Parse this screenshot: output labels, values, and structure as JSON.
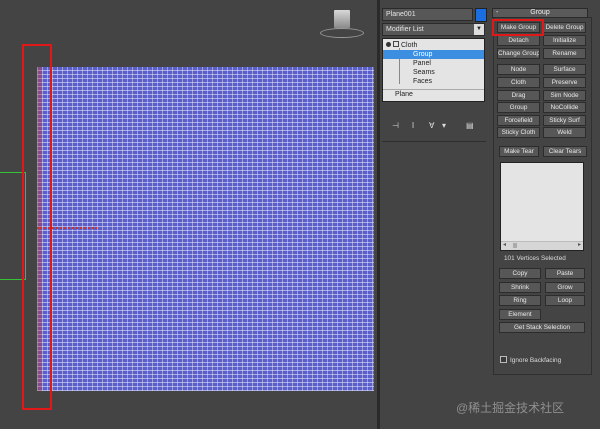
{
  "object": {
    "name": "Plane001",
    "color": "#1a6ee0"
  },
  "modifier_list": {
    "label": "Modifier List"
  },
  "stack": {
    "items": [
      {
        "label": "Cloth"
      },
      {
        "label": "Group"
      },
      {
        "label": "Panel"
      },
      {
        "label": "Seams"
      },
      {
        "label": "Faces"
      }
    ],
    "base": "Plane"
  },
  "rollout": {
    "title": "Group",
    "buttons": [
      "Make Group",
      "Delete Group",
      "Detach",
      "Initialize",
      "Change Group",
      "Rename",
      "Node",
      "Surface",
      "Cloth",
      "Preserve",
      "Drag",
      "Sim Node",
      "Group",
      "NoCollide",
      "Forcefield",
      "Sticky Surf",
      "Sticky Cloth",
      "Weld"
    ],
    "tear_buttons": [
      "Make Tear",
      "Clear Tears"
    ],
    "selected_label": "101 Vertices Selected",
    "select_buttons": [
      "Copy",
      "Paste",
      "Shrink",
      "Grow",
      "Ring",
      "Loop",
      "Element"
    ],
    "stack_selection": "Get Stack Selection",
    "ignore_backfacing": "Ignore Backfacing"
  },
  "watermark": "@稀土掘金技术社区"
}
